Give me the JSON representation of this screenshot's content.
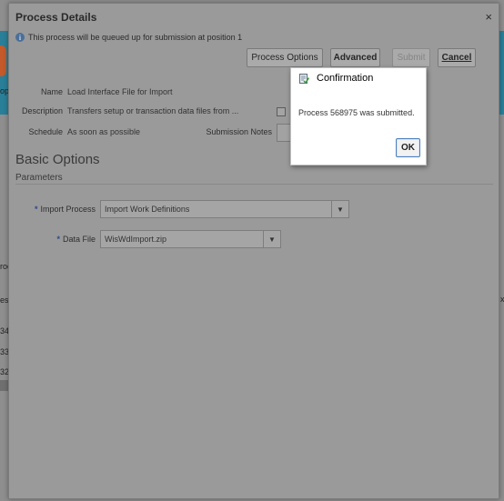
{
  "background": {
    "edge_fragments": [
      "op",
      "roc",
      "es",
      "34",
      "33",
      "32"
    ],
    "right_fragment": "x"
  },
  "dialog": {
    "title": "Process Details",
    "close_glyph": "×",
    "info_icon_glyph": "i",
    "info_text": "This process will be queued up for submission at position 1",
    "buttons": {
      "process_options": "Process Options",
      "advanced": "Advanced",
      "submit": "Submit",
      "cancel": "Cancel"
    },
    "fields": {
      "name_label": "Name",
      "name_value": "Load Interface File for Import",
      "description_label": "Description",
      "description_value": "Transfers setup or transaction data files from ...",
      "schedule_label": "Schedule",
      "schedule_value": "As soon as possible",
      "submission_notes_label": "Submission Notes"
    },
    "basic_options_title": "Basic Options",
    "parameters_title": "Parameters",
    "required_marker": "*",
    "import_process": {
      "label": "Import Process",
      "value": "Import Work Definitions"
    },
    "data_file": {
      "label": "Data File",
      "value": "WisWdImport.zip"
    },
    "dropdown_glyph": "▼"
  },
  "confirmation": {
    "title": "Confirmation",
    "message": "Process 568975 was submitted.",
    "ok_label": "OK"
  }
}
